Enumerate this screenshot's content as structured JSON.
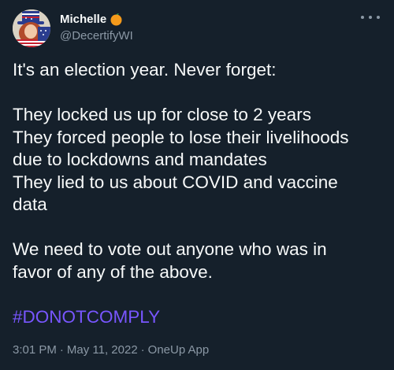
{
  "user": {
    "display_name": "Michelle",
    "handle": "@DecertifyWI",
    "badge_icon": "orange-icon"
  },
  "tweet": {
    "lines": [
      "It's an election year. Never forget:",
      "",
      "They locked us up for close to 2 years",
      "They forced people to lose their livelihoods",
      "due to lockdowns and mandates",
      "They lied to us about COVID and vaccine",
      "data",
      "",
      "We need to vote out anyone who was in",
      "favor of any of the above."
    ],
    "hashtag": "#DONOTCOMPLY"
  },
  "meta": {
    "time": "3:01 PM",
    "separator": "·",
    "date": "May 11, 2022",
    "source": "OneUp App"
  },
  "colors": {
    "background": "#15202b",
    "text": "#f7f9f9",
    "secondary": "#8b98a5",
    "hashtag": "#7856ff"
  }
}
